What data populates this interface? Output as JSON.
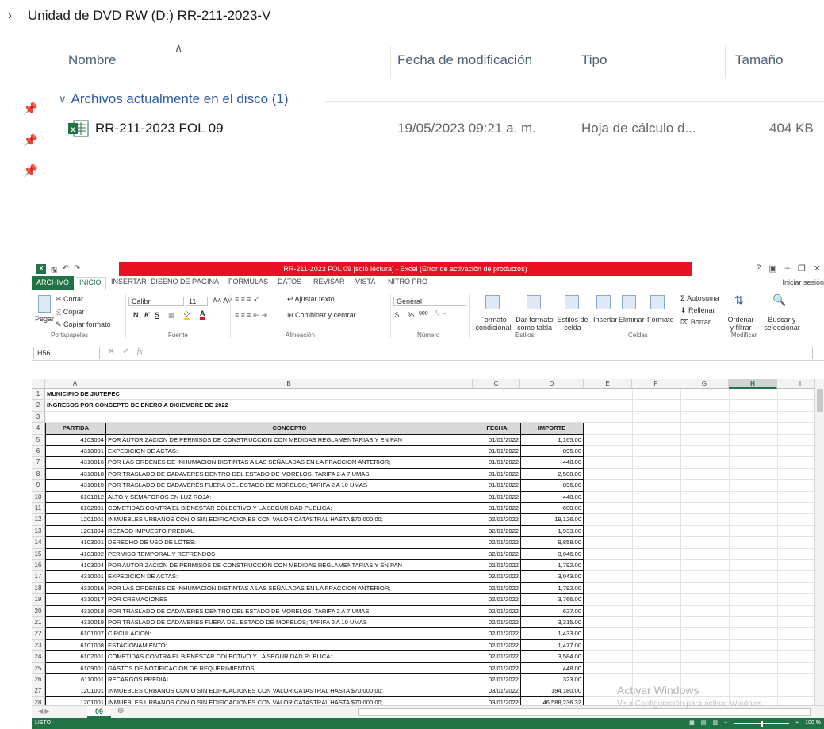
{
  "explorer": {
    "breadcrumb": "Unidad de DVD RW (D:) RR-211-2023-V",
    "columns": {
      "name": "Nombre",
      "date": "Fecha de modificación",
      "type": "Tipo",
      "size": "Tamaño"
    },
    "group_label": "Archivos actualmente en el disco (1)",
    "file": {
      "name": "RR-211-2023 FOL 09",
      "date": "19/05/2023 09:21 a. m.",
      "type": "Hoja de cálculo d...",
      "size": "404 KB"
    }
  },
  "excel": {
    "title": "RR-211-2023 FOL 09  [solo lectura] -  Excel (Error de activación de productos)",
    "tabs": [
      "ARCHIVO",
      "INICIO",
      "INSERTAR",
      "DISEÑO DE PÁGINA",
      "FÓRMULAS",
      "DATOS",
      "REVISAR",
      "VISTA",
      "NITRO PRO"
    ],
    "signin": "Iniciar sesión",
    "ribbon": {
      "clipboard": {
        "paste": "Pegar",
        "cut": "Cortar",
        "copy": "Copiar",
        "format_painter": "Copiar formato",
        "group": "Portapapeles"
      },
      "font": {
        "name": "Calibri",
        "size": "11",
        "bold": "N",
        "italic": "K",
        "underline": "S",
        "group": "Fuente"
      },
      "alignment": {
        "wrap": "Ajustar texto",
        "merge": "Combinar y centrar",
        "group": "Alineación"
      },
      "number": {
        "format": "General",
        "currency": "$",
        "percent": "%",
        "thousands": "000",
        "group": "Número"
      },
      "styles": {
        "conditional": "Formato condicional",
        "table": "Dar formato como tabla",
        "cell_styles": "Estilos de celda",
        "group": "Estilos"
      },
      "cells": {
        "insert": "Insertar",
        "delete": "Eliminar",
        "format": "Formato",
        "group": "Celdas"
      },
      "editing": {
        "autosum": "Autosuma",
        "fill": "Rellenar",
        "clear": "Borrar",
        "sort": "Ordenar y filtrar",
        "find": "Buscar y seleccionar",
        "group": "Modificar"
      }
    },
    "name_box": "H56",
    "fx": "fx",
    "columns": [
      "A",
      "B",
      "C",
      "D",
      "E",
      "F",
      "G",
      "H",
      "I"
    ],
    "selected_column": "H",
    "sheet": {
      "title1": "MUNICIPIO DE JIUTEPEC",
      "title2": "INGRESOS POR CONCEPTO DE ENERO A DICIEMBRE DE 2022",
      "headers": [
        "PARTIDA",
        "CONCEPTO",
        "FECHA",
        "IMPORTE"
      ],
      "rows": [
        [
          "4103004",
          "POR AUTORIZACION DE PERMISOS DE CONSTRUCCION CON MEDIDAS REGLAMENTARIAS Y EN PAN",
          "01/01/2022",
          "1,165.00"
        ],
        [
          "4310001",
          "EXPEDICION DE ACTAS:",
          "01/01/2022",
          "895.00"
        ],
        [
          "4310016",
          "POR LAS ORDENES DE INHUMACION DISTINTAS A LAS SEÑALADAS EN LA FRACCION ANTERIOR;",
          "01/01/2022",
          "448.00"
        ],
        [
          "4310018",
          "POR TRASLADO DE CADAVERES DENTRO DEL ESTADO DE MORELOS; TARIFA 2 A 7 UMAS",
          "01/01/2022",
          "2,508.00"
        ],
        [
          "4310019",
          "POR TRASLADO DE CADAVERES FUERA DEL ESTADO DE MORELOS; TARIFA 2 A 10 UMAS",
          "01/01/2022",
          "896.00"
        ],
        [
          "6101012",
          "ALTO Y SEMAFOROS EN LUZ ROJA:",
          "01/01/2022",
          "448.00"
        ],
        [
          "6102001",
          "COMETIDAS CONTRA EL BIENESTAR COLECTIVO Y LA SEGURIDAD PUBLICA:",
          "01/01/2022",
          "600.00"
        ],
        [
          "1201001",
          "INMUEBLES URBANOS CON O SIN EDIFICACIONES CON VALOR CATASTRAL HASTA $70 000.00;",
          "02/01/2022",
          "19,126.00"
        ],
        [
          "1201004",
          "REZAGO IMPUESTO PREDIAL",
          "02/01/2022",
          "1,933.00"
        ],
        [
          "4103001",
          "DERECHO DE USO DE LOTES:",
          "02/01/2022",
          "9,858.00"
        ],
        [
          "4103002",
          "PERMISO TEMPORAL Y REFRENDOS",
          "02/01/2022",
          "3,046.00"
        ],
        [
          "4103004",
          "POR AUTORIZACION DE PERMISOS DE CONSTRUCCION CON MEDIDAS REGLAMENTARIAS Y EN PAN",
          "02/01/2022",
          "1,792.00"
        ],
        [
          "4310001",
          "EXPEDICION DE ACTAS:",
          "02/01/2022",
          "3,043.00"
        ],
        [
          "4310016",
          "POR LAS ORDENES DE INHUMACION DISTINTAS A LAS SEÑALADAS EN LA FRACCION ANTERIOR;",
          "02/01/2022",
          "1,792.00"
        ],
        [
          "4310017",
          "POR CREMACIONES",
          "02/01/2022",
          "3,766.00"
        ],
        [
          "4310018",
          "POR TRASLADO DE CADAVERES DENTRO DEL ESTADO DE MORELOS; TARIFA 2 A 7 UMAS",
          "02/01/2022",
          "627.00"
        ],
        [
          "4310019",
          "POR TRASLADO DE CADAVERES FUERA DEL ESTADO DE MORELOS; TARIFA 2 A 10 UMAS",
          "02/01/2022",
          "3,315.00"
        ],
        [
          "6101007",
          "CIRCULACION:",
          "02/01/2022",
          "1,433.00"
        ],
        [
          "6101008",
          "ESTACIONAMIENTO:",
          "02/01/2022",
          "1,477.00"
        ],
        [
          "6102001",
          "COMETIDAS CONTRA EL BIENESTAR COLECTIVO Y LA SEGURIDAD PUBLICA:",
          "02/01/2022",
          "3,584.00"
        ],
        [
          "6109001",
          "GASTOS DE NOTIFICACION DE REQUERIMIENTOS",
          "02/01/2022",
          "448.00"
        ],
        [
          "6110001",
          "RECARGOS PREDIAL",
          "02/01/2022",
          "323.00"
        ],
        [
          "1201001",
          "INMUEBLES URBANOS CON O SIN EDIFICACIONES CON VALOR CATASTRAL HASTA $70 000.00;",
          "03/01/2022",
          "194,180.00"
        ],
        [
          "1201001",
          "INMUEBLES URBANOS CON O SIN EDIFICACIONES CON VALOR CATASTRAL HASTA $70 000.00;",
          "03/01/2022",
          "46,588,236.32"
        ]
      ]
    },
    "sheet_tab": "09",
    "status": "LISTO",
    "zoom": "100 %"
  },
  "watermark": {
    "line1": "Activar Windows",
    "line2": "Ve a Configuración para activar Windows."
  },
  "colors": {
    "excel_green": "#217346",
    "title_red": "#e81123",
    "link_blue": "#2c5ca6"
  }
}
